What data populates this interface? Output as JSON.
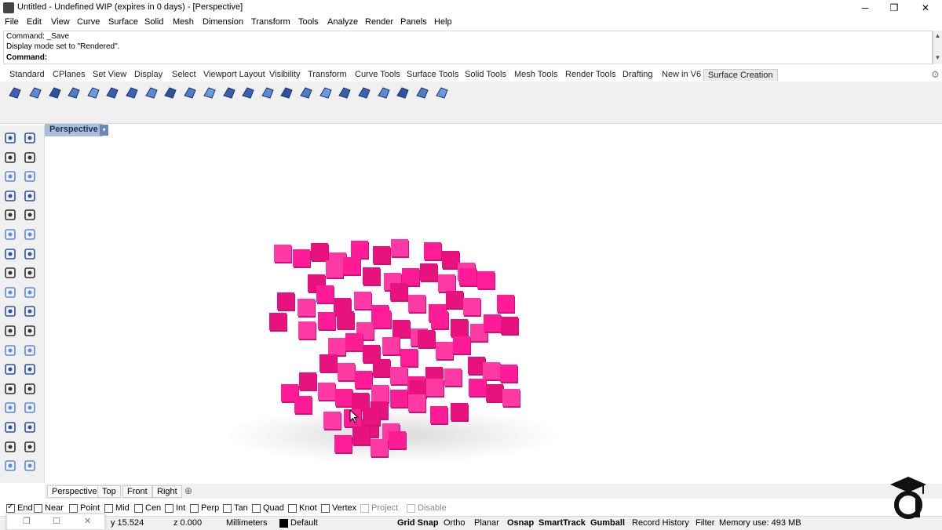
{
  "window": {
    "title": "Untitled - Undefined WIP (expires in 0 days) - [Perspective]",
    "minimize": "─",
    "restore": "❐",
    "close": "✕"
  },
  "menu": [
    "File",
    "Edit",
    "View",
    "Curve",
    "Surface",
    "Solid",
    "Mesh",
    "Dimension",
    "Transform",
    "Tools",
    "Analyze",
    "Render",
    "Panels",
    "Help"
  ],
  "command": {
    "history1": "Command: _Save",
    "history2": "Display mode set to \"Rendered\".",
    "prompt": "Command:"
  },
  "toolbar_tabs": [
    "Standard",
    "CPlanes",
    "Set View",
    "Display",
    "Select",
    "Viewport Layout",
    "Visibility",
    "Transform",
    "Curve Tools",
    "Surface Tools",
    "Solid Tools",
    "Mesh Tools",
    "Render Tools",
    "Drafting",
    "New in V6",
    "Surface Creation"
  ],
  "active_toolbar_tab": "Surface Creation",
  "viewport": {
    "label": "Perspective",
    "arrow": "▾"
  },
  "view_tabs": [
    "Perspective",
    "Top",
    "Front",
    "Right"
  ],
  "add_view_tab": "⊕",
  "osnaps": [
    {
      "label": "End",
      "checked": true
    },
    {
      "label": "Near",
      "checked": false
    },
    {
      "label": "Point",
      "checked": false
    },
    {
      "label": "Mid",
      "checked": false
    },
    {
      "label": "Cen",
      "checked": false
    },
    {
      "label": "Int",
      "checked": false
    },
    {
      "label": "Perp",
      "checked": false
    },
    {
      "label": "Tan",
      "checked": false
    },
    {
      "label": "Quad",
      "checked": false
    },
    {
      "label": "Knot",
      "checked": false
    },
    {
      "label": "Vertex",
      "checked": false
    },
    {
      "label": "Project",
      "checked": false,
      "disabled": true
    },
    {
      "label": "Disable",
      "checked": false,
      "disabled": true
    }
  ],
  "status": {
    "y": "y 15.524",
    "z": "z 0.000",
    "units": "Millimeters",
    "layer": "Default",
    "grid_snap": "Grid Snap",
    "ortho": "Ortho",
    "planar": "Planar",
    "osnap": "Osnap",
    "smarttrack": "SmartTrack",
    "gumball": "Gumball",
    "record_history": "Record History",
    "filter": "Filter",
    "memory": "Memory use: 493 MB"
  },
  "colors": {
    "cubes": "#ff1c96",
    "viewport_label": "#a9bedd"
  }
}
